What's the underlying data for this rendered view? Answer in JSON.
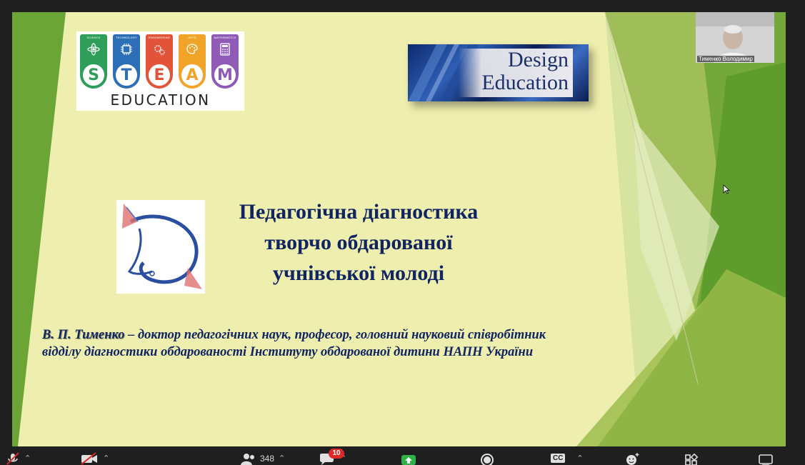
{
  "slide": {
    "steam_logo": {
      "columns": [
        {
          "caption": "SCIENCE",
          "letter": "S",
          "color": "#2e9e5a"
        },
        {
          "caption": "TECHNOLOGY",
          "letter": "T",
          "color": "#2c6fb6"
        },
        {
          "caption": "ENGINEERING",
          "letter": "E",
          "color": "#e2543a"
        },
        {
          "caption": "ARTS",
          "letter": "A",
          "color": "#f0a428"
        },
        {
          "caption": "MATHEMATICS",
          "letter": "M",
          "color": "#8f5bb6"
        }
      ],
      "education": "EDUCATION"
    },
    "design_education": {
      "line1": "Design",
      "line2": "Education"
    },
    "title_lines": [
      "Педагогічна діагностика",
      "творчо обдарованої",
      "учнівської молоді"
    ],
    "author_name": "В. П. Тименко",
    "author_rest": " – доктор педагогічних наук, професор, головний науковий співробітник",
    "author_line2": "відділу діагностики обдарованості  Інституту обдарованої дитини НАПН України",
    "colors": {
      "background": "#eeeeaf",
      "text": "#0f2460",
      "green": "#6aa535"
    }
  },
  "participant": {
    "name": "Тименко Володимир"
  },
  "toolbar": {
    "participants_count": "348",
    "chat_badge": "10",
    "cc_label": "CC",
    "icons": [
      "mic-muted-icon",
      "video-off-icon",
      "participants-icon",
      "chat-icon",
      "share-screen-icon",
      "record-icon",
      "captions-icon",
      "reactions-icon",
      "apps-icon",
      "more-icon"
    ]
  }
}
